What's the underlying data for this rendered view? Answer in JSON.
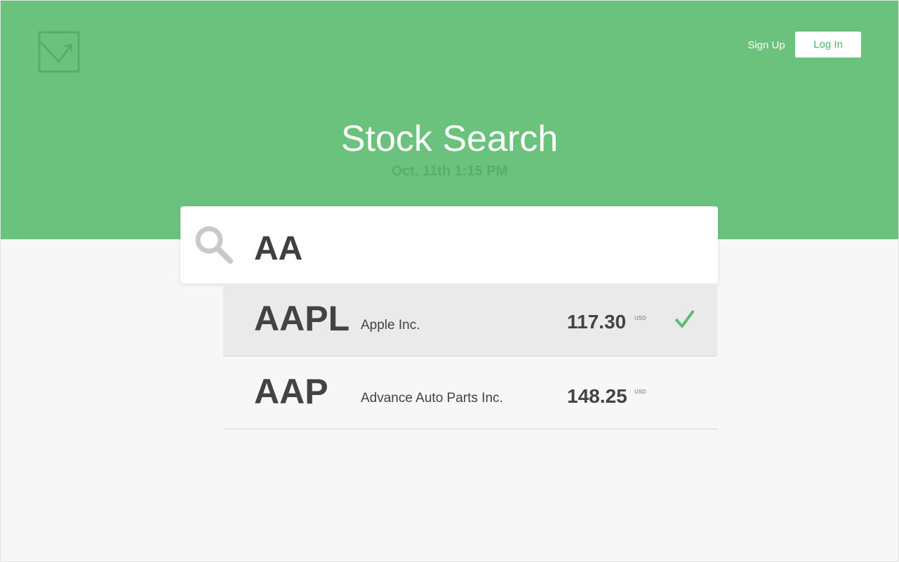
{
  "header": {
    "signup_label": "Sign Up",
    "login_label": "Log In"
  },
  "hero": {
    "title": "Stock Search",
    "datetime": "Oct. 11th 1:15 PM"
  },
  "search": {
    "value": "AA"
  },
  "results": [
    {
      "ticker": "AAPL",
      "name": "Apple Inc.",
      "price": "117.30",
      "currency": "USD",
      "selected": true
    },
    {
      "ticker": "AAP",
      "name": "Advance Auto Parts Inc.",
      "price": "148.25",
      "currency": "USD",
      "selected": false
    }
  ],
  "colors": {
    "brand_green": "#6ac27c",
    "check_green": "#5cbd70",
    "text_dark": "#424443"
  }
}
